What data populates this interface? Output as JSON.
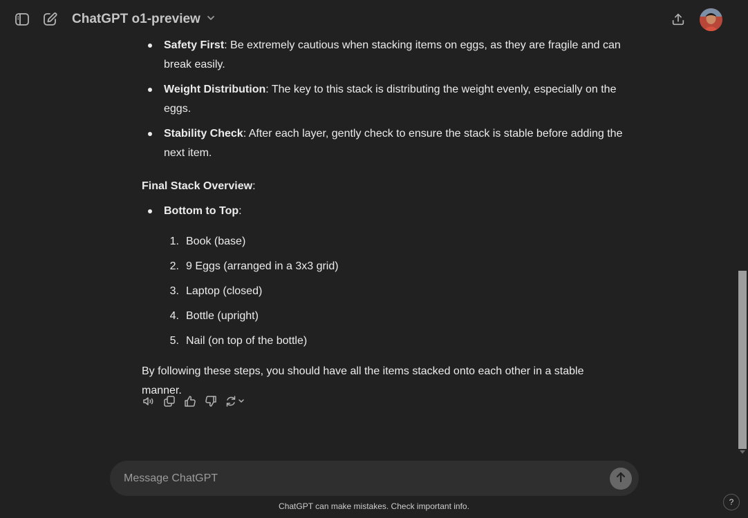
{
  "header": {
    "model_title": "ChatGPT o1-preview"
  },
  "bullets": [
    {
      "bold": "Safety First",
      "rest": ": Be extremely cautious when stacking items on eggs, as they are fragile and can break easily."
    },
    {
      "bold": "Weight Distribution",
      "rest": ": The key to this stack is distributing the weight evenly, especially on the eggs."
    },
    {
      "bold": "Stability Check",
      "rest": ": After each layer, gently check to ensure the stack is stable before adding the next item."
    }
  ],
  "overview": {
    "heading": "Final Stack Overview",
    "heading_colon": ":",
    "sub_bold": "Bottom to Top",
    "sub_colon": ":",
    "steps": [
      {
        "num": "1.",
        "text": "Book (base)"
      },
      {
        "num": "2.",
        "text": "9 Eggs (arranged in a 3x3 grid)"
      },
      {
        "num": "3.",
        "text": "Laptop (closed)"
      },
      {
        "num": "4.",
        "text": "Bottle (upright)"
      },
      {
        "num": "5.",
        "text": "Nail (on top of the bottle)"
      }
    ]
  },
  "final_paragraph": "By following these steps, you should have all the items stacked onto each other in a stable manner.",
  "composer": {
    "placeholder": "Message ChatGPT"
  },
  "footer_note": "ChatGPT can make mistakes. Check important info.",
  "help_label": "?",
  "icons": {
    "sidebar_toggle": "sidebar-toggle-icon",
    "new_chat": "new-chat-icon",
    "model_chevron": "chevron-down-icon",
    "share": "share-icon",
    "read_aloud": "speaker-icon",
    "copy": "copy-icon",
    "thumbs_up": "thumbs-up-icon",
    "thumbs_down": "thumbs-down-icon",
    "regenerate": "regenerate-icon",
    "send": "arrow-up-icon"
  }
}
